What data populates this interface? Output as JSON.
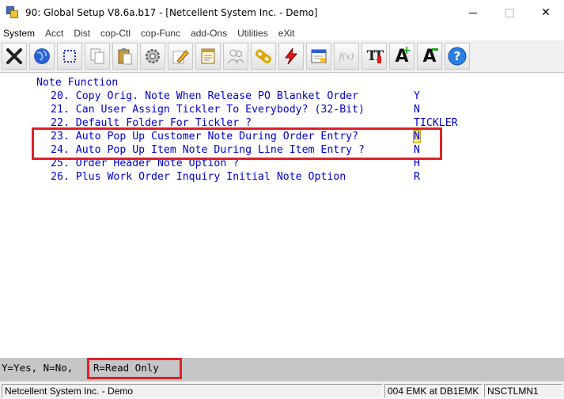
{
  "window": {
    "title": "90: Global Setup V8.6a.b17 - [Netcellent System Inc. - Demo]",
    "close_glyph": "✕"
  },
  "menu": [
    "System",
    "Acct",
    "Dist",
    "cop-Ctl",
    "cop-Func",
    "add-Ons",
    "Utilities",
    "eXit"
  ],
  "toolbar": {
    "icons": [
      "exit-icon",
      "globe-icon",
      "select-icon",
      "copy-icon",
      "paste-icon",
      "settings-icon",
      "edit-icon",
      "notepad-icon",
      "users-icon",
      "link-icon",
      "lightning-icon",
      "window-icon",
      "function-icon",
      "font-icon",
      "font-increase-icon",
      "font-decrease-icon",
      "help-icon"
    ],
    "font_label": "TT",
    "font_up_label": "A",
    "font_down_label": "A",
    "help_label": "?",
    "func_label": "f(x)"
  },
  "section": {
    "title": "Note Function"
  },
  "items": [
    {
      "label": "20. Copy Orig. Note When Release PO Blanket Order",
      "value": "Y"
    },
    {
      "label": "21. Can User Assign Tickler To Everybody? (32-Bit)",
      "value": "N"
    },
    {
      "label": "22. Default Folder For Tickler ?",
      "value": "TICKLER"
    },
    {
      "label": "23. Auto Pop Up Customer Note During Order Entry?",
      "value": "N"
    },
    {
      "label": "24. Auto Pop Up Item Note During Line Item Entry ?",
      "value": "N"
    },
    {
      "label": "25. Order Header Note Option ?",
      "value": "H"
    },
    {
      "label": "26. Plus Work Order Inquiry Initial Note Option",
      "value": "R"
    }
  ],
  "hint": {
    "part1": "Y=Yes, N=No,",
    "part2": "R=Read Only"
  },
  "status": {
    "company": "Netcellent System Inc. - Demo",
    "session": "004 EMK at DB1EMK",
    "program": "NSCTLMN1"
  },
  "colors": {
    "text_blue": "#0000cc",
    "highlight_red": "#e0202a",
    "hint_bg": "#c6c6c6"
  }
}
